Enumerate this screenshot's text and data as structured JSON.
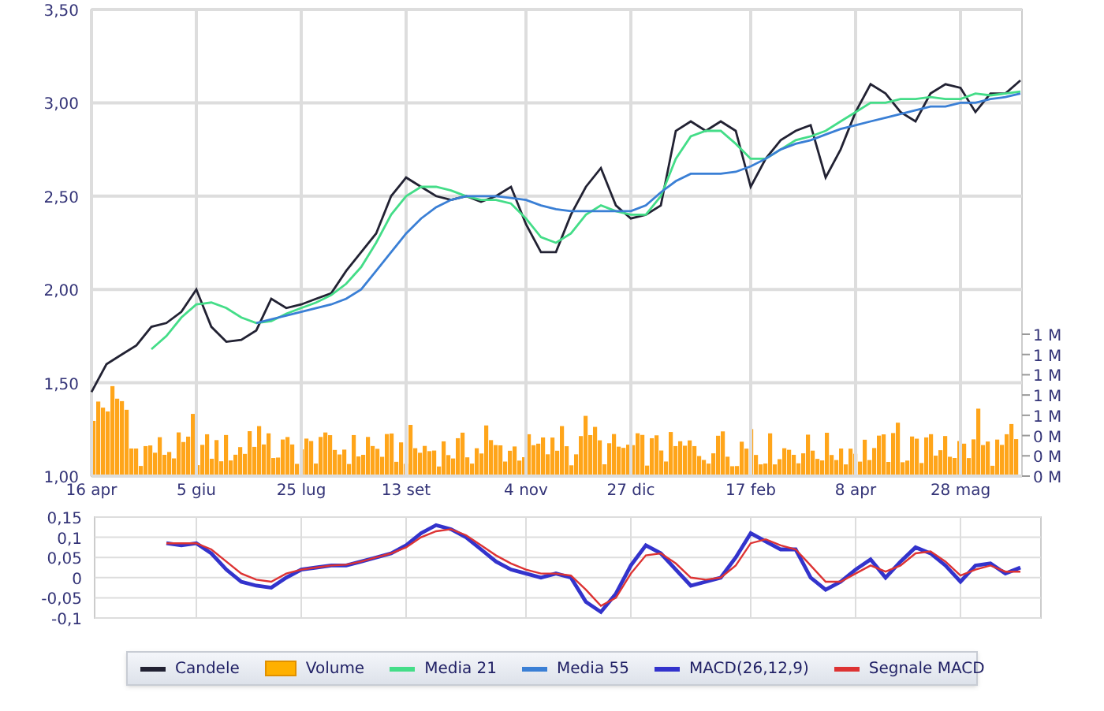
{
  "price_chart": {
    "chart_data": {
      "type": "line",
      "grid": true,
      "ylim": [
        1,
        3.5
      ],
      "categories": [
        "16 apr",
        null,
        null,
        null,
        null,
        null,
        null,
        "5 giu",
        null,
        null,
        null,
        null,
        null,
        null,
        "25 lug",
        null,
        null,
        null,
        null,
        null,
        null,
        "13 set",
        null,
        null,
        null,
        null,
        null,
        null,
        null,
        "4 nov",
        null,
        null,
        null,
        null,
        null,
        null,
        "27 dic",
        null,
        null,
        null,
        null,
        null,
        null,
        null,
        "17 feb",
        null,
        null,
        null,
        null,
        null,
        null,
        "8 apr",
        null,
        null,
        null,
        null,
        null,
        null,
        "28 mag",
        null,
        null,
        null,
        null
      ],
      "yticks": [
        {
          "value": 3.5,
          "label": "3,50"
        },
        {
          "value": 3,
          "label": "3,00"
        },
        {
          "value": 2.5,
          "label": "2,50"
        },
        {
          "value": 2,
          "label": "2,00"
        },
        {
          "value": 1.5,
          "label": "1,50"
        },
        {
          "value": 1,
          "label": "1,00"
        }
      ],
      "series": [
        {
          "name": "Candele",
          "color": "#222233",
          "values": [
            1.45,
            1.6,
            1.65,
            1.7,
            1.8,
            1.82,
            1.88,
            2.0,
            1.8,
            1.72,
            1.73,
            1.78,
            1.95,
            1.9,
            1.92,
            1.95,
            1.98,
            2.1,
            2.2,
            2.3,
            2.5,
            2.6,
            2.55,
            2.5,
            2.48,
            2.5,
            2.47,
            2.5,
            2.55,
            2.35,
            2.2,
            2.2,
            2.4,
            2.55,
            2.65,
            2.45,
            2.38,
            2.4,
            2.45,
            2.85,
            2.9,
            2.85,
            2.9,
            2.85,
            2.55,
            2.7,
            2.8,
            2.85,
            2.88,
            2.6,
            2.75,
            2.95,
            3.1,
            3.05,
            2.95,
            2.9,
            3.05,
            3.1,
            3.08,
            2.95,
            3.05,
            3.05,
            3.12
          ]
        },
        {
          "name": "Media 21",
          "color": "#44dd88",
          "values": [
            null,
            null,
            null,
            null,
            1.68,
            1.75,
            1.85,
            1.92,
            1.93,
            1.9,
            1.85,
            1.82,
            1.83,
            1.87,
            1.9,
            1.93,
            1.97,
            2.03,
            2.12,
            2.25,
            2.4,
            2.5,
            2.55,
            2.55,
            2.53,
            2.5,
            2.48,
            2.48,
            2.46,
            2.38,
            2.28,
            2.25,
            2.3,
            2.4,
            2.45,
            2.42,
            2.4,
            2.4,
            2.5,
            2.7,
            2.82,
            2.85,
            2.85,
            2.78,
            2.7,
            2.7,
            2.75,
            2.8,
            2.82,
            2.85,
            2.9,
            2.95,
            3.0,
            3.0,
            3.02,
            3.02,
            3.03,
            3.02,
            3.02,
            3.05,
            3.04,
            3.05,
            3.06
          ]
        },
        {
          "name": "Media 55",
          "color": "#3a7fd5",
          "values": [
            null,
            null,
            null,
            null,
            null,
            null,
            null,
            null,
            null,
            null,
            null,
            1.82,
            1.84,
            1.86,
            1.88,
            1.9,
            1.92,
            1.95,
            2.0,
            2.1,
            2.2,
            2.3,
            2.38,
            2.44,
            2.48,
            2.5,
            2.5,
            2.5,
            2.49,
            2.48,
            2.45,
            2.43,
            2.42,
            2.42,
            2.42,
            2.42,
            2.42,
            2.45,
            2.52,
            2.58,
            2.62,
            2.62,
            2.62,
            2.63,
            2.66,
            2.7,
            2.75,
            2.78,
            2.8,
            2.83,
            2.86,
            2.88,
            2.9,
            2.92,
            2.94,
            2.96,
            2.98,
            2.98,
            3.0,
            3.0,
            3.02,
            3.03,
            3.05
          ]
        }
      ]
    },
    "volume_axis": [
      "1 M",
      "1 M",
      "1 M",
      "1 M",
      "1 M",
      "0 M",
      "0 M",
      "0 M"
    ]
  },
  "macd_chart": {
    "chart_data": {
      "type": "line",
      "grid": true,
      "ylim": [
        -0.1,
        0.15
      ],
      "yticks": [
        {
          "value": 0.15,
          "label": "0,15"
        },
        {
          "value": 0.1,
          "label": "0,1"
        },
        {
          "value": 0.05,
          "label": "0,05"
        },
        {
          "value": 0,
          "label": "0"
        },
        {
          "value": -0.05,
          "label": "-0,05"
        },
        {
          "value": -0.1,
          "label": "-0,1"
        }
      ],
      "series": [
        {
          "name": "MACD(26,12,9)",
          "color": "#3333cc",
          "values": [
            null,
            null,
            null,
            null,
            null,
            0.085,
            0.08,
            0.085,
            0.06,
            0.02,
            -0.01,
            -0.02,
            -0.025,
            0.0,
            0.02,
            0.025,
            0.03,
            0.03,
            0.04,
            0.05,
            0.06,
            0.08,
            0.11,
            0.13,
            0.12,
            0.1,
            0.07,
            0.04,
            0.02,
            0.01,
            0.0,
            0.01,
            0.0,
            -0.06,
            -0.085,
            -0.04,
            0.03,
            0.08,
            0.06,
            0.02,
            -0.02,
            -0.01,
            0.0,
            0.05,
            0.11,
            0.09,
            0.07,
            0.07,
            0.0,
            -0.03,
            -0.01,
            0.02,
            0.045,
            0.0,
            0.04,
            0.075,
            0.06,
            0.03,
            -0.01,
            0.03,
            0.035,
            0.01,
            0.025
          ]
        },
        {
          "name": "Segnale MACD",
          "color": "#dd3333",
          "values": [
            null,
            null,
            null,
            null,
            null,
            0.085,
            0.085,
            0.085,
            0.07,
            0.04,
            0.01,
            -0.005,
            -0.01,
            0.01,
            0.02,
            0.025,
            0.03,
            0.032,
            0.04,
            0.05,
            0.06,
            0.075,
            0.1,
            0.115,
            0.12,
            0.105,
            0.08,
            0.055,
            0.035,
            0.02,
            0.01,
            0.01,
            0.005,
            -0.03,
            -0.07,
            -0.05,
            0.01,
            0.055,
            0.06,
            0.035,
            0.0,
            -0.005,
            0.0,
            0.03,
            0.085,
            0.095,
            0.08,
            0.07,
            0.03,
            -0.01,
            -0.01,
            0.01,
            0.03,
            0.015,
            0.03,
            0.06,
            0.065,
            0.04,
            0.005,
            0.02,
            0.03,
            0.015,
            0.015
          ]
        }
      ]
    }
  },
  "legend": [
    {
      "kind": "series"
    },
    {
      "kind": "volume",
      "label": "Volume",
      "color": "#ffb000"
    },
    {
      "kind": "series"
    },
    {
      "kind": "series"
    },
    {
      "kind": "series"
    },
    {
      "kind": "series"
    }
  ]
}
